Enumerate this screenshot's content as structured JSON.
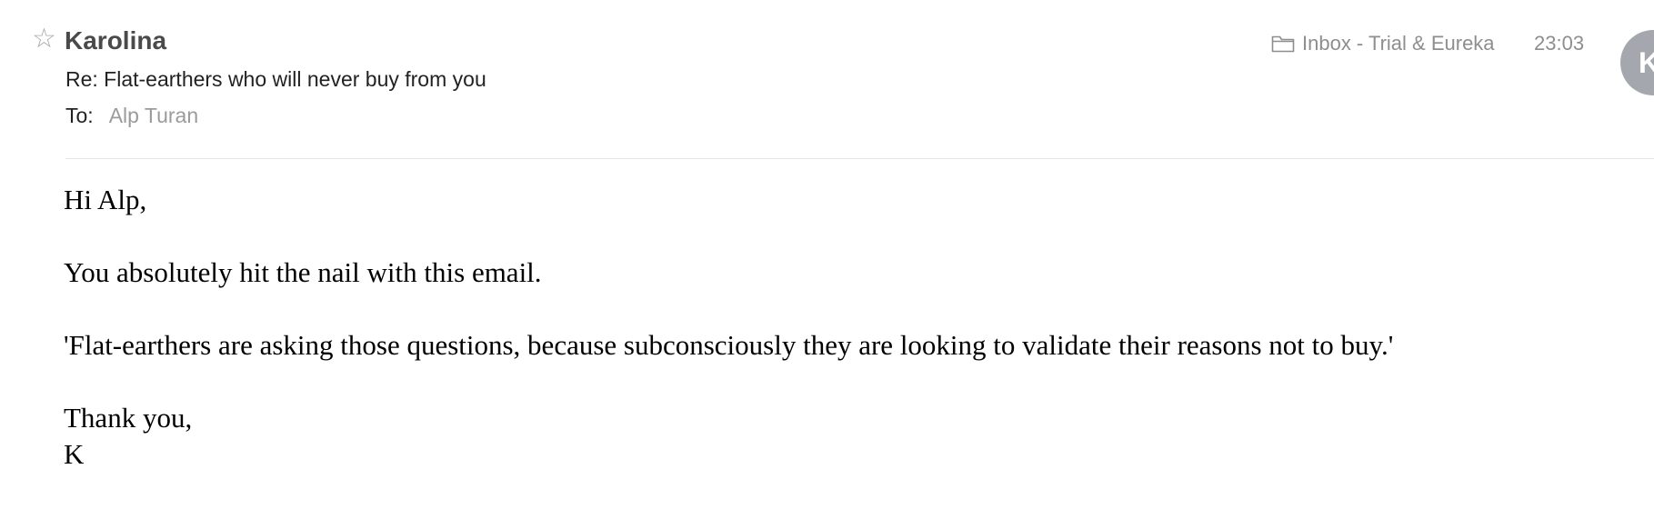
{
  "message": {
    "star_icon": "star-outline-icon",
    "sender": "Karolina",
    "subject": "Re: Flat-earthers who will never buy from you",
    "to_label": "To:",
    "to_value": "Alp Turan",
    "mailbox_icon": "folder-icon",
    "mailbox": "Inbox - Trial & Eureka",
    "time": "23:03",
    "avatar_initial": "K",
    "avatar_color": "#a4a8ae"
  },
  "body": {
    "greeting": "Hi Alp,",
    "line1": "You absolutely hit the nail with this email.",
    "line2": "'Flat-earthers are asking those questions, because subconsciously they are looking to validate their reasons not to buy.'",
    "closing": "Thank you,",
    "signature": "K"
  }
}
